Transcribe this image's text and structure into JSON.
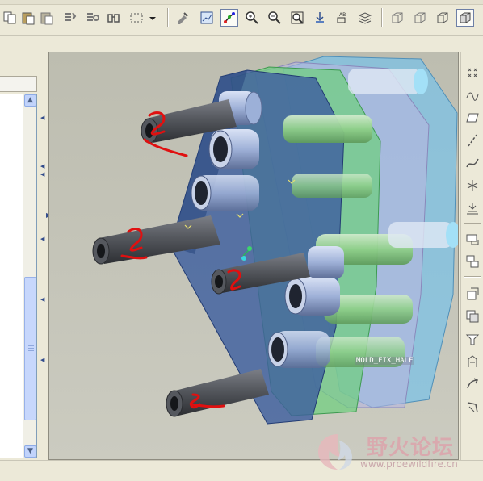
{
  "toolbar": {
    "buttons": [
      {
        "id": "copy",
        "icon": "copy-icon"
      },
      {
        "id": "paste",
        "icon": "paste-icon"
      },
      {
        "id": "paste-special",
        "icon": "paste-special-icon"
      },
      {
        "id": "regenerate",
        "icon": "regenerate-icon"
      },
      {
        "id": "regen-manager",
        "icon": "regen-manager-icon"
      },
      {
        "id": "find",
        "icon": "find-icon"
      },
      {
        "id": "select-box",
        "icon": "select-box-icon"
      },
      {
        "id": "select-dropdown",
        "icon": "dropdown-arrow-icon"
      },
      {
        "id": "repaint",
        "icon": "repaint-icon"
      },
      {
        "id": "view-display",
        "icon": "view-display-icon"
      },
      {
        "id": "spin-center",
        "icon": "spin-center-icon"
      },
      {
        "id": "zoom-in",
        "icon": "zoom-in-icon"
      },
      {
        "id": "zoom-out",
        "icon": "zoom-out-icon"
      },
      {
        "id": "refit",
        "icon": "refit-icon"
      },
      {
        "id": "orient",
        "icon": "orient-icon"
      },
      {
        "id": "named-views",
        "icon": "named-views-icon"
      },
      {
        "id": "layers",
        "icon": "layers-icon"
      },
      {
        "id": "wireframe",
        "icon": "wireframe-icon"
      },
      {
        "id": "hidden-line",
        "icon": "hidden-line-icon"
      },
      {
        "id": "no-hidden",
        "icon": "no-hidden-icon"
      },
      {
        "id": "shading",
        "icon": "shading-icon"
      }
    ]
  },
  "viewport": {
    "part_label": "MOLD_FIX_HALF",
    "background": "#c4c4b8",
    "plate_colors": {
      "front": "#3f5fa0",
      "middle": "#7fd08a",
      "back": "#86c8e8"
    }
  },
  "right_toolbar": {
    "buttons": [
      {
        "id": "datum-point",
        "icon": "datum-point-icon"
      },
      {
        "id": "sketch-curve",
        "icon": "sketch-curve-icon"
      },
      {
        "id": "datum-plane",
        "icon": "datum-plane-icon"
      },
      {
        "id": "datum-axis",
        "icon": "datum-axis-icon"
      },
      {
        "id": "datum-curve",
        "icon": "datum-curve-icon"
      },
      {
        "id": "coordinate-system",
        "icon": "coordinate-system-icon"
      },
      {
        "id": "analysis",
        "icon": "analysis-icon"
      },
      {
        "id": "parting-surface",
        "icon": "parting-surface-icon"
      },
      {
        "id": "split-volume",
        "icon": "split-volume-icon"
      },
      {
        "id": "mold-volume",
        "icon": "mold-volume-icon"
      },
      {
        "id": "extract",
        "icon": "extract-icon"
      },
      {
        "id": "runner",
        "icon": "runner-icon"
      },
      {
        "id": "waterline",
        "icon": "waterline-icon"
      },
      {
        "id": "mold-opening",
        "icon": "mold-opening-icon"
      },
      {
        "id": "draft-check",
        "icon": "draft-check-icon"
      }
    ]
  },
  "watermark": {
    "title": "野火论坛",
    "url": "www.proewildfire.cn",
    "logo": "wildfire-logo-icon"
  }
}
